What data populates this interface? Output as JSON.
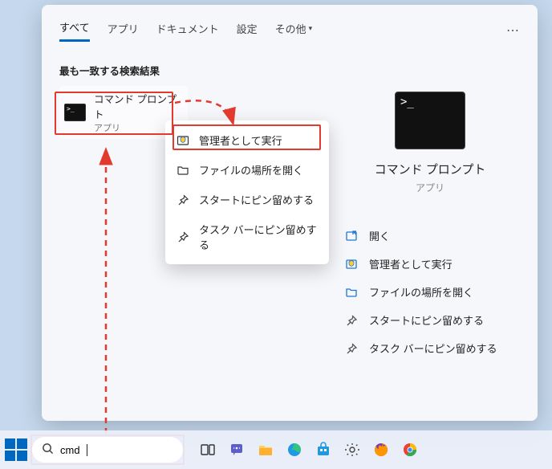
{
  "tabs": {
    "all": "すべて",
    "apps": "アプリ",
    "documents": "ドキュメント",
    "settings": "設定",
    "more": "その他"
  },
  "section_label": "最も一致する検索結果",
  "result": {
    "title": "コマンド プロンプト",
    "subtitle": "アプリ"
  },
  "context_menu": {
    "run_admin": "管理者として実行",
    "open_location": "ファイルの場所を開く",
    "pin_start": "スタートにピン留めする",
    "pin_taskbar": "タスク バーにピン留めする"
  },
  "preview": {
    "title": "コマンド プロンプト",
    "subtitle": "アプリ"
  },
  "actions": {
    "open": "開く",
    "run_admin": "管理者として実行",
    "open_location": "ファイルの場所を開く",
    "pin_start": "スタートにピン留めする",
    "pin_taskbar": "タスク バーにピン留めする"
  },
  "search": {
    "value": "cmd"
  },
  "colors": {
    "accent": "#0067c0",
    "highlight": "#e33a2f"
  }
}
